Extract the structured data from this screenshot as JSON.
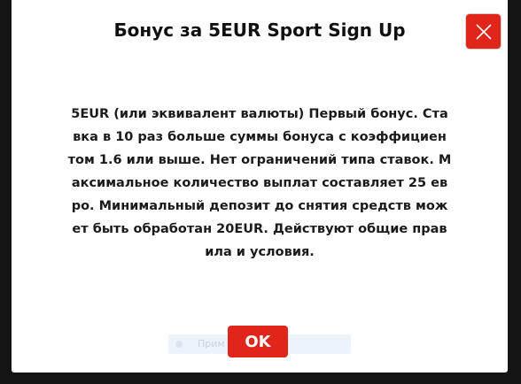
{
  "dialog": {
    "title": "Бонус за 5EUR Sport Sign Up",
    "body_lines": [
      "5EUR (или эквивалент валюты) Первый бонус. Ста",
      "вка в 10 раз больше суммы бонуса с коэффициен",
      "том 1.6 или выше. Нет ограничений типа ставок. М",
      "аксимальное количество выплат составляет 25 ев",
      "ро. Минимальный депозит до снятия средств мож",
      "ет быть обработан 20EUR. Действуют общие прав",
      "ила и условия."
    ],
    "ok_label": "OK",
    "close_icon": "close-icon",
    "background_hint": "Прим"
  },
  "colors": {
    "accent": "#e0261b",
    "overlay": "#141414",
    "panel": "#ffffff",
    "text": "#1b1b1b"
  }
}
